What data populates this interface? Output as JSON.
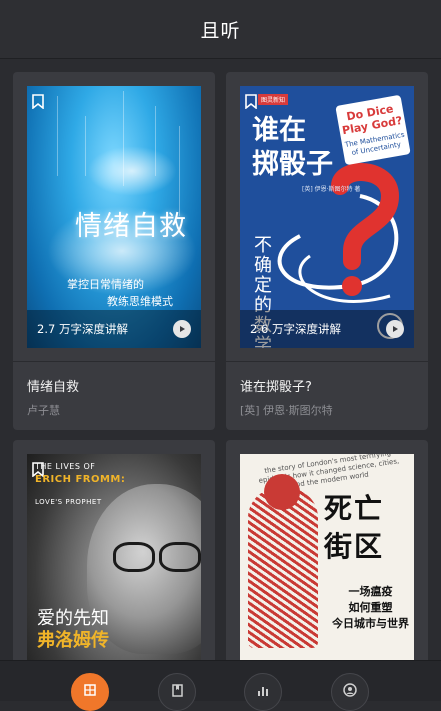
{
  "header": {
    "title": "且听"
  },
  "books": [
    {
      "title": "情绪自救",
      "author": "卢子慧",
      "word_count": "2.7 万字深度讲解",
      "cover": {
        "main_text": "情绪自救",
        "line1": "掌控日常情绪的",
        "line2": "教练思维模式"
      }
    },
    {
      "title": "谁在掷骰子?",
      "author": "[英] 伊恩·斯图尔特",
      "word_count": "2.6 万字深度讲解",
      "cover": {
        "main_line1": "谁在",
        "main_line2": "掷骰子",
        "side_text": "不确定的数学",
        "bubble_title": "Do Dice Play God?",
        "bubble_sub": "The Mathematics of Uncertainty",
        "badge": "图灵新知",
        "cn_author": "[英] 伊恩·斯图尔特 著"
      }
    },
    {
      "title": "爱的先知",
      "author": "",
      "word_count": "",
      "cover": {
        "en_line1": "THE LIVES OF",
        "en_line2": "ERICH FROMM:",
        "en_line3": "LOVE'S PROPHET",
        "zh_line1": "爱的先知",
        "zh_line2": "弗洛姆传"
      }
    },
    {
      "title": "死亡街区",
      "author": "",
      "word_count": "",
      "cover": {
        "en_top": "the story of London's most terrifying epidemic how it changed science, cities, and the modern world",
        "zh_big_line1": "死亡",
        "zh_big_line2": "街区",
        "zh_sub_line1": "一场瘟疫",
        "zh_sub_line2": "如何重塑",
        "zh_sub_line3": "今日城市与世界"
      }
    }
  ],
  "nav": [
    {
      "name": "library",
      "icon": "grid-icon",
      "active": true
    },
    {
      "name": "books",
      "icon": "book-icon",
      "active": false
    },
    {
      "name": "stats",
      "icon": "bar-chart-icon",
      "active": false
    },
    {
      "name": "profile",
      "icon": "user-icon",
      "active": false
    }
  ],
  "colors": {
    "background": "#2b2c30",
    "card": "#3a3b40",
    "accent": "#f0772a",
    "muted_text": "#8d8e93"
  }
}
